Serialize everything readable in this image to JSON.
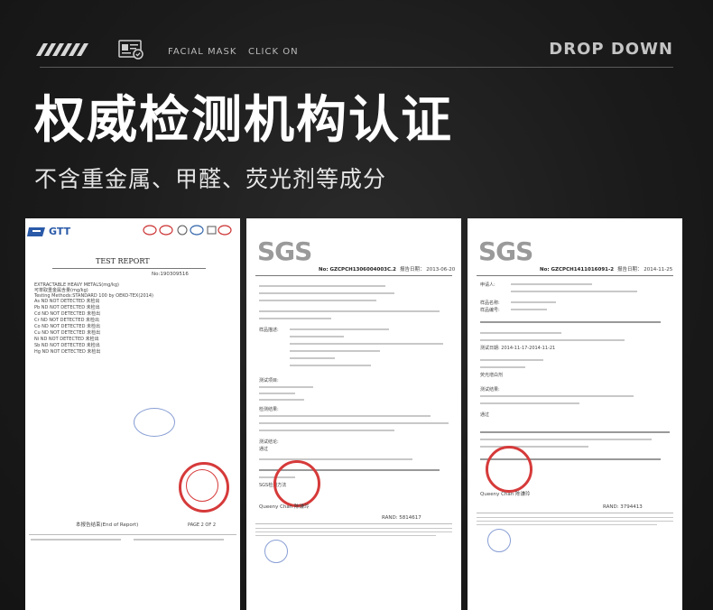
{
  "header": {
    "nav_items": [
      "FACIAL MASK",
      "CLICK ON"
    ],
    "drop_label": "DROP DOWN"
  },
  "hero": {
    "title": "权威检测机构认证",
    "subtitle": "不含重金属、甲醛、荧光剂等成分"
  },
  "docs": [
    {
      "brand": "GTT",
      "heading": "TEST REPORT",
      "number": "No:190309516",
      "footer": "本报告结束(End of Report)",
      "page": "PAGE 2 OF 2",
      "lines": [
        "EXTRACTABLE HEAVY METALS(mg/kg)",
        "可萃取重金属含量(mg/kg)",
        "Testing Methods:STANDARD 100 by OEKO-TEX(2014)",
        "As  ND  NOT DETECTED 未检出",
        "Pb  ND  NOT DETECTED 未检出",
        "Cd  ND  NOT DETECTED 未检出",
        "Cr  ND  NOT DETECTED 未检出",
        "Co  ND  NOT DETECTED 未检出",
        "Cu  ND  NOT DETECTED 未检出",
        "Ni  ND  NOT DETECTED 未检出",
        "Sb  ND  NOT DETECTED 未检出",
        "Hg  ND  NOT DETECTED 未检出"
      ]
    },
    {
      "brand": "SGS",
      "number": "No: GZCPCH1306004003C.2",
      "date": "报告日期： 2013-06-20",
      "sign": "Queeny Chan 陈谦玲",
      "rand": "RAND: 5814617",
      "lines": [
        "测试项目:",
        "样品描述:",
        "检测结果:",
        "测试结论:",
        "通过",
        "甲醛含量要求:",
        "SGS检测方法"
      ]
    },
    {
      "brand": "SGS",
      "number": "No: GZCPCH1411016091-2",
      "date": "报告日期： 2014-11-25",
      "sign": "Queeny Chan 陈谦玲",
      "rand": "RAND: 3794413",
      "lines": [
        "申请人:",
        "样品名称:",
        "样品编号:",
        "测试日期: 2014-11-17-2014-11-21",
        "测试结果:",
        "荧光增白剂",
        "通过"
      ]
    }
  ]
}
